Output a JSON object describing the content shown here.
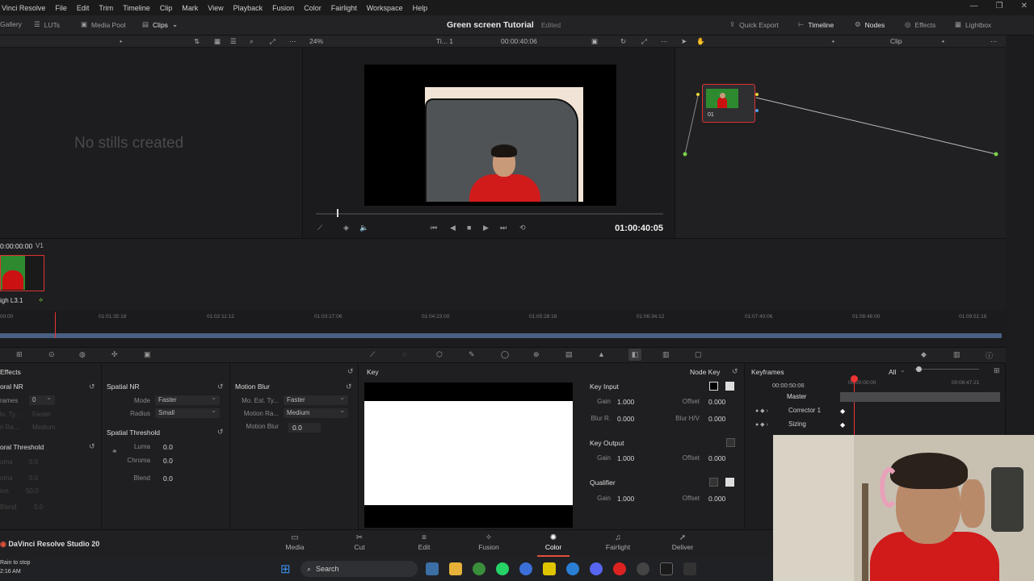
{
  "menu": [
    "Vinci Resolve",
    "File",
    "Edit",
    "Trim",
    "Timeline",
    "Clip",
    "Mark",
    "View",
    "Playback",
    "Fusion",
    "Color",
    "Fairlight",
    "Workspace",
    "Help"
  ],
  "toolbar": {
    "gallery": "Gallery",
    "luts": "LUTs",
    "media_pool": "Media Pool",
    "clips": "Clips",
    "project_title": "Green screen Tutorial",
    "project_status": "Edited",
    "quick_export": "Quick Export",
    "timeline": "Timeline",
    "nodes": "Nodes",
    "effects": "Effects",
    "lightbox": "Lightbox"
  },
  "viewer_bar": {
    "zoom": "24%",
    "timeline_name": "Ti... 1",
    "timecode": "00:00:40:06",
    "mode": "Clip"
  },
  "gallery": {
    "empty_text": "No stills created"
  },
  "viewer": {
    "timecode": "01:00:40:05"
  },
  "node": {
    "label": "01"
  },
  "clip_strip": {
    "timecode": "0:00:00:00",
    "track": "V1",
    "clip_label": "igh L3.1"
  },
  "mini_timeline": {
    "ticks": [
      "00:00",
      "01:01:35:18",
      "01:02:11:12",
      "01:03:17:06",
      "01:04:23:00",
      "01:05:28:18",
      "01:06:34:12",
      "01:07:40:06",
      "01:08:46:00",
      "01:09:51:18"
    ]
  },
  "panels": {
    "effects_title": "Effects",
    "left_nr": {
      "title": "oral NR",
      "frames_label": "rames",
      "frames_value": "0",
      "mo_est_label": "lo. Ty...",
      "mo_est_value": "Faster",
      "radius_label": "n Ra...",
      "radius_value": "Medium",
      "threshold_title": "oral Threshold",
      "luma_label": "uma",
      "luma_value": "0.0",
      "chroma_label": "oma",
      "chroma_value": "0.0",
      "mo_label": "ion",
      "mo_value": "50.0",
      "blend_label": "Blend",
      "blend_value": "0.0"
    },
    "spatial_nr": {
      "title": "Spatial NR",
      "mode_label": "Mode",
      "mode_value": "Faster",
      "radius_label": "Radius",
      "radius_value": "Small",
      "threshold_title": "Spatial Threshold",
      "luma_label": "Luma",
      "luma_value": "0.0",
      "chroma_label": "Chroma",
      "chroma_value": "0.0",
      "blend_label": "Blend",
      "blend_value": "0.0"
    },
    "motion_blur": {
      "title": "Motion Blur",
      "mo_est_label": "Mo. Est. Ty...",
      "mo_est_value": "Faster",
      "motion_range_label": "Motion Ra...",
      "motion_range_value": "Medium",
      "motion_blur_label": "Motion Blur",
      "motion_blur_value": "0.0"
    },
    "key": {
      "title": "Key",
      "node_key": "Node Key",
      "key_input": "Key Input",
      "gain_label": "Gain",
      "gain_value": "1.000",
      "offset_label": "Offset",
      "offset_value": "0.000",
      "blur_r_label": "Blur R.",
      "blur_r_value": "0.000",
      "blur_hv_label": "Blur H/V",
      "blur_hv_value": "0.000",
      "key_output": "Key Output",
      "out_gain_value": "1.000",
      "out_offset_value": "0.000",
      "qualifier": "Qualifier",
      "q_gain_value": "1.000",
      "q_offset_value": "0.000"
    },
    "keyframes": {
      "title": "Keyframes",
      "filter": "All",
      "tc_left": "00:00:50:06",
      "tc_mid": "00:00:00:00",
      "tc_right": "00:08:47:21",
      "rows": [
        "Master",
        "Corrector 1",
        "Sizing"
      ]
    }
  },
  "pages": [
    {
      "label": "Media",
      "icon": "▭"
    },
    {
      "label": "Cut",
      "icon": "✂"
    },
    {
      "label": "Edit",
      "icon": "≡"
    },
    {
      "label": "Fusion",
      "icon": "✧"
    },
    {
      "label": "Color",
      "icon": "✺"
    },
    {
      "label": "Fairlight",
      "icon": "♫"
    },
    {
      "label": "Deliver",
      "icon": "➚"
    }
  ],
  "active_page": "Color",
  "app_name": "DaVinci Resolve Studio 20",
  "taskbar": {
    "weather": "Rain to stop",
    "time": "2:16 AM",
    "search": "Search"
  },
  "colors": {
    "accent": "#e0503a",
    "selection": "#dd3333",
    "green_screen": "#2e8a2e"
  }
}
